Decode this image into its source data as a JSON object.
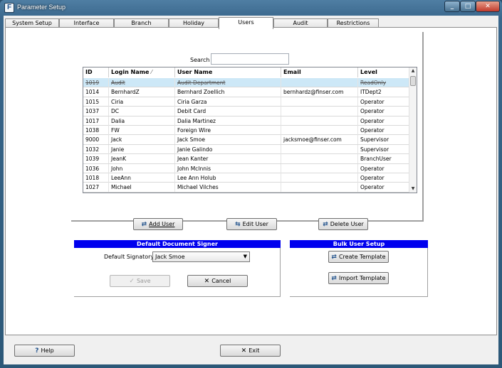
{
  "window": {
    "title": "Parameter Setup",
    "min": "_",
    "max": "□",
    "close": "✕"
  },
  "tabs": [
    "System Setup",
    "Interface",
    "Branch",
    "Holiday Calendar",
    "Users",
    "Audit",
    "Restrictions"
  ],
  "search": {
    "label": "Search",
    "value": ""
  },
  "grid": {
    "columns": [
      "ID",
      "Login Name",
      "User Name",
      "Email",
      "Level"
    ],
    "sort_indicator": "⁄",
    "rows": [
      [
        "1019",
        "Audit",
        "Audit Department",
        "",
        "ReadOnly"
      ],
      [
        "1014",
        "BernhardZ",
        "Bernhard Zoellich",
        "bernhardz@finser.com",
        "ITDept2"
      ],
      [
        "1015",
        "Ciria",
        "Ciria Garza",
        "",
        "Operator"
      ],
      [
        "1037",
        "DC",
        "Debit Card",
        "",
        "Operator"
      ],
      [
        "1017",
        "Dalia",
        "Dalia Martinez",
        "",
        "Operator"
      ],
      [
        "1038",
        "FW",
        "Foreign Wire",
        "",
        "Operator"
      ],
      [
        "9000",
        "Jack",
        "Jack Smoe",
        "jacksmoe@finser.com",
        "Supervisor"
      ],
      [
        "1032",
        "Janie",
        "Janie Galindo",
        "",
        "Supervisor"
      ],
      [
        "1039",
        "JeanK",
        "Jean Kanter",
        "",
        "BranchUser"
      ],
      [
        "1036",
        "John",
        "John McInnis",
        "",
        "Operator"
      ],
      [
        "1018",
        "LeeAnn",
        "Lee Ann Holub",
        "",
        "Operator"
      ],
      [
        "1027",
        "Michael",
        "Michael Vilches",
        "",
        "Operator"
      ]
    ],
    "selected_row": 0
  },
  "user_buttons": {
    "add": "Add User",
    "edit": "Edit User",
    "delete": "Delete User"
  },
  "signer": {
    "header": "Default Document Signer",
    "label": "Default Signatory",
    "value": "Jack Smoe",
    "save": "Save",
    "cancel": "Cancel"
  },
  "bulk": {
    "header": "Bulk User Setup",
    "create": "Create Template",
    "import": "Import Template"
  },
  "footer": {
    "help": "Help",
    "exit": "Exit"
  },
  "colors": {
    "accent_header": "#0000ee",
    "selected_row": "#cde8f7",
    "window_frame": "#3a678c"
  }
}
